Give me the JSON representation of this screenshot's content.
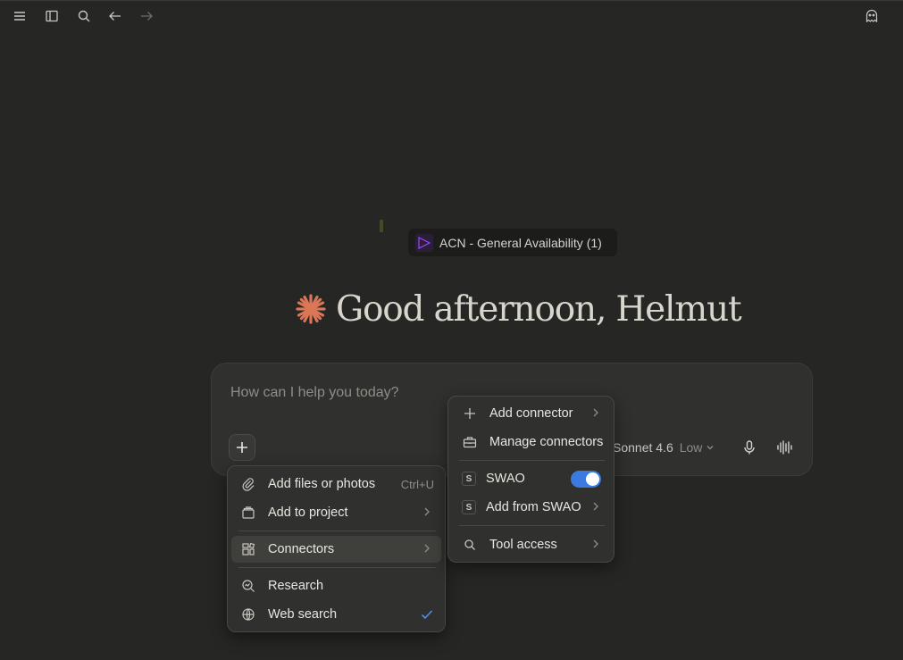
{
  "chat": {
    "pinned_label": "ACN - General Availability (1)",
    "greeting": "Good afternoon, Helmut",
    "input_placeholder": "How can I help you today?",
    "model_name": "Sonnet 4.6",
    "model_effort": "Low"
  },
  "attach_menu": {
    "add_files": "Add files or photos",
    "add_files_shortcut": "Ctrl+U",
    "add_project": "Add to project",
    "connectors": "Connectors",
    "research": "Research",
    "web_search": "Web search"
  },
  "connectors_menu": {
    "add_connector": "Add connector",
    "manage_connectors": "Manage connectors",
    "swao": "SWAO",
    "swao_badge": "S",
    "swao_enabled": true,
    "add_from_swao": "Add from SWAO",
    "tool_access": "Tool access"
  },
  "colors": {
    "accent_star": "#d97757",
    "toggle_on": "#3b7be0",
    "check": "#4a8ff2"
  }
}
